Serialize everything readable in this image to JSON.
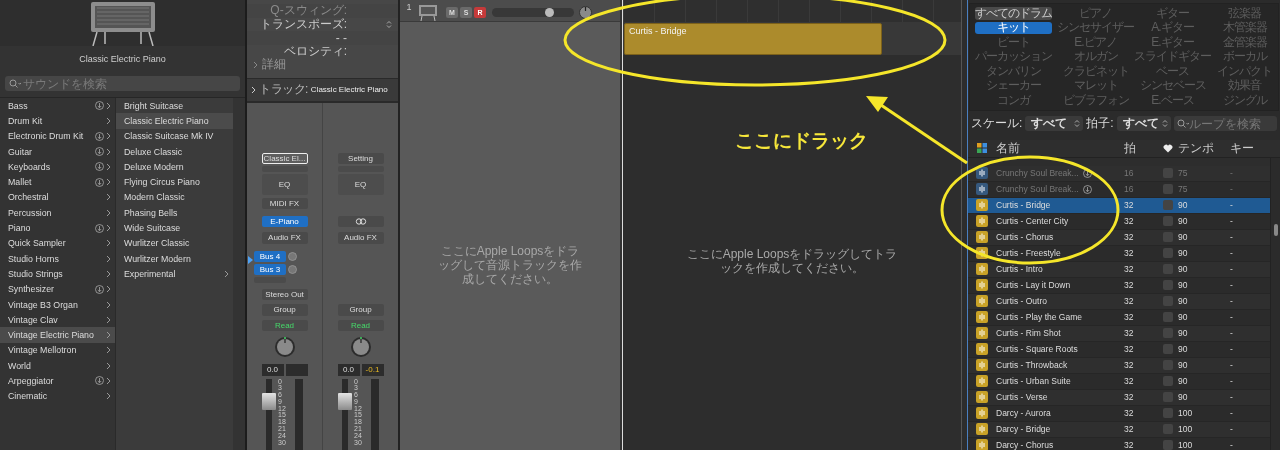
{
  "library": {
    "title": "Classic Electric Piano",
    "search": {
      "placeholder": "サウンドを検索"
    },
    "categories": [
      {
        "label": "Bass",
        "downloadable": true,
        "selected": false
      },
      {
        "label": "Drum Kit",
        "downloadable": false,
        "selected": false
      },
      {
        "label": "Electronic Drum Kit",
        "downloadable": true,
        "selected": false
      },
      {
        "label": "Guitar",
        "downloadable": true,
        "selected": false
      },
      {
        "label": "Keyboards",
        "downloadable": true,
        "selected": false
      },
      {
        "label": "Mallet",
        "downloadable": true,
        "selected": false
      },
      {
        "label": "Orchestral",
        "downloadable": false,
        "selected": false
      },
      {
        "label": "Percussion",
        "downloadable": false,
        "selected": false
      },
      {
        "label": "Piano",
        "downloadable": true,
        "selected": false
      },
      {
        "label": "Quick Sampler",
        "downloadable": false,
        "selected": false
      },
      {
        "label": "Studio Horns",
        "downloadable": false,
        "selected": false
      },
      {
        "label": "Studio Strings",
        "downloadable": false,
        "selected": false
      },
      {
        "label": "Synthesizer",
        "downloadable": true,
        "selected": false
      },
      {
        "label": "Vintage B3 Organ",
        "downloadable": false,
        "selected": false
      },
      {
        "label": "Vintage Clav",
        "downloadable": false,
        "selected": false
      },
      {
        "label": "Vintage Electric Piano",
        "downloadable": false,
        "selected": true
      },
      {
        "label": "Vintage Mellotron",
        "downloadable": false,
        "selected": false
      },
      {
        "label": "World",
        "downloadable": false,
        "selected": false
      },
      {
        "label": "Arpeggiator",
        "downloadable": true,
        "selected": false
      },
      {
        "label": "Cinematic",
        "downloadable": false,
        "selected": false
      }
    ],
    "presets": [
      {
        "label": "Bright Suitcase",
        "selected": false,
        "submenu": false
      },
      {
        "label": "Classic Electric Piano",
        "selected": true,
        "submenu": false
      },
      {
        "label": "Classic Suitcase Mk IV",
        "selected": false,
        "submenu": false
      },
      {
        "label": "Deluxe Classic",
        "selected": false,
        "submenu": false
      },
      {
        "label": "Deluxe Modern",
        "selected": false,
        "submenu": false
      },
      {
        "label": "Flying Circus Piano",
        "selected": false,
        "submenu": false
      },
      {
        "label": "Modern Classic",
        "selected": false,
        "submenu": false
      },
      {
        "label": "Phasing Bells",
        "selected": false,
        "submenu": false
      },
      {
        "label": "Wide Suitcase",
        "selected": false,
        "submenu": false
      },
      {
        "label": "Wurlitzer Classic",
        "selected": false,
        "submenu": false
      },
      {
        "label": "Wurlitzer Modern",
        "selected": false,
        "submenu": false
      },
      {
        "label": "Experimental",
        "selected": false,
        "submenu": true
      }
    ]
  },
  "inspector": {
    "rows": [
      {
        "label": "Q-スウィング:",
        "kind": "plain",
        "disabled": true
      },
      {
        "label": "トランスポーズ:",
        "kind": "stepper",
        "disabled": false
      },
      {
        "label": "- -",
        "kind": "value",
        "disabled": false
      },
      {
        "label": "ベロシティ:",
        "kind": "plain",
        "disabled": false
      }
    ],
    "details": "詳細",
    "track_header": {
      "label": "トラック:",
      "name": "Classic Electric Piano"
    },
    "strips": [
      {
        "selected": true,
        "setting": "Classic El...",
        "eq": "EQ",
        "midi_fx": "MIDI FX",
        "instrument": "E-Piano",
        "link": false,
        "audio_fx": "Audio FX",
        "sends": [
          {
            "label": "Bus 4"
          },
          {
            "label": "Bus 3"
          }
        ],
        "output": "Stereo Out",
        "group": "Group",
        "automation": "Read",
        "volume": "0.0",
        "level": 0.73,
        "scale": [
          "0",
          "3",
          "6",
          "9",
          "12",
          "15",
          "18",
          "21",
          "24",
          "30"
        ]
      },
      {
        "selected": false,
        "setting": "Setting",
        "eq": "EQ",
        "link": true,
        "audio_fx": "Audio FX",
        "group": "Group",
        "automation": "Read",
        "volume": "0.0",
        "peak": "-0.1",
        "level": 0.73,
        "scale": [
          "0",
          "3",
          "6",
          "9",
          "12",
          "15",
          "18",
          "21",
          "24",
          "30"
        ]
      }
    ]
  },
  "track": {
    "number": "1",
    "buttons": [
      {
        "label": "M",
        "kind": "mute",
        "on": false
      },
      {
        "label": "S",
        "kind": "solo",
        "on": false
      },
      {
        "label": "R",
        "kind": "record",
        "on": true
      }
    ],
    "volume": {
      "level": 0.72
    },
    "hint": "ここにApple Loopsをドラッグして音源トラックを作成してください。"
  },
  "workspace": {
    "region": {
      "name": "Curtis - Bridge"
    },
    "hint": "ここにApple Loopsをドラッグしてトラックを作成してください。"
  },
  "loop_browser": {
    "categories": [
      {
        "label": "すべてのドラム",
        "selected": false,
        "disabled": false
      },
      {
        "label": "ピアノ",
        "selected": false,
        "disabled": true
      },
      {
        "label": "ギター",
        "selected": false,
        "disabled": true
      },
      {
        "label": "弦楽器",
        "selected": false,
        "disabled": true
      },
      {
        "label": "キット",
        "selected": true,
        "disabled": false
      },
      {
        "label": "シンセサイザー",
        "selected": false,
        "disabled": true
      },
      {
        "label": "A.ギター",
        "selected": false,
        "disabled": true
      },
      {
        "label": "木管楽器",
        "selected": false,
        "disabled": true
      },
      {
        "label": "ビート",
        "selected": false,
        "disabled": true
      },
      {
        "label": "E.ピアノ",
        "selected": false,
        "disabled": true
      },
      {
        "label": "E.ギター",
        "selected": false,
        "disabled": true
      },
      {
        "label": "金管楽器",
        "selected": false,
        "disabled": true
      },
      {
        "label": "パーカッション",
        "selected": false,
        "disabled": true
      },
      {
        "label": "オルガン",
        "selected": false,
        "disabled": true
      },
      {
        "label": "スライドギター",
        "selected": false,
        "disabled": true
      },
      {
        "label": "ボーカル",
        "selected": false,
        "disabled": true
      },
      {
        "label": "タンバリン",
        "selected": false,
        "disabled": true
      },
      {
        "label": "クラビネット",
        "selected": false,
        "disabled": true
      },
      {
        "label": "ベース",
        "selected": false,
        "disabled": true
      },
      {
        "label": "インパクト",
        "selected": false,
        "disabled": true
      },
      {
        "label": "シェーカー",
        "selected": false,
        "disabled": true
      },
      {
        "label": "マレット",
        "selected": false,
        "disabled": true
      },
      {
        "label": "シンセベース",
        "selected": false,
        "disabled": true
      },
      {
        "label": "効果音",
        "selected": false,
        "disabled": true
      },
      {
        "label": "コンガ",
        "selected": false,
        "disabled": true
      },
      {
        "label": "ビブラフォン",
        "selected": false,
        "disabled": true
      },
      {
        "label": "E.ベース",
        "selected": false,
        "disabled": true
      },
      {
        "label": "ジングル",
        "selected": false,
        "disabled": true
      }
    ],
    "filters": [
      {
        "label": "スケール:",
        "value": "すべて"
      },
      {
        "label": "拍子:",
        "value": "すべて"
      }
    ],
    "search": {
      "placeholder": "ループを検索"
    },
    "columns": {
      "name": "名前",
      "beats": "拍",
      "tempo": "テンポ",
      "key": "キー"
    },
    "rows": [
      {
        "name": "Crunchy Soul Break...",
        "beats": "16",
        "tempo": "75",
        "key": "-",
        "color": "#36597e",
        "disabled": true,
        "downloadable": true,
        "favorite": false,
        "selected": false
      },
      {
        "name": "Crunchy Soul Break...",
        "beats": "16",
        "tempo": "75",
        "key": "-",
        "color": "#36597e",
        "disabled": true,
        "downloadable": true,
        "favorite": false,
        "selected": false
      },
      {
        "name": "Curtis - Bridge",
        "beats": "32",
        "tempo": "90",
        "key": "-",
        "color": "#c9a227",
        "disabled": false,
        "downloadable": false,
        "favorite": false,
        "selected": true
      },
      {
        "name": "Curtis - Center City",
        "beats": "32",
        "tempo": "90",
        "key": "-",
        "color": "#c9a227",
        "disabled": false,
        "downloadable": false,
        "favorite": false,
        "selected": false
      },
      {
        "name": "Curtis - Chorus",
        "beats": "32",
        "tempo": "90",
        "key": "-",
        "color": "#c9a227",
        "disabled": false,
        "downloadable": false,
        "favorite": false,
        "selected": false
      },
      {
        "name": "Curtis - Freestyle",
        "beats": "32",
        "tempo": "90",
        "key": "-",
        "color": "#c9a227",
        "disabled": false,
        "downloadable": false,
        "favorite": false,
        "selected": false
      },
      {
        "name": "Curtis - Intro",
        "beats": "32",
        "tempo": "90",
        "key": "-",
        "color": "#c9a227",
        "disabled": false,
        "downloadable": false,
        "favorite": false,
        "selected": false
      },
      {
        "name": "Curtis - Lay it Down",
        "beats": "32",
        "tempo": "90",
        "key": "-",
        "color": "#c9a227",
        "disabled": false,
        "downloadable": false,
        "favorite": false,
        "selected": false
      },
      {
        "name": "Curtis - Outro",
        "beats": "32",
        "tempo": "90",
        "key": "-",
        "color": "#c9a227",
        "disabled": false,
        "downloadable": false,
        "favorite": false,
        "selected": false
      },
      {
        "name": "Curtis - Play the Game",
        "beats": "32",
        "tempo": "90",
        "key": "-",
        "color": "#c9a227",
        "disabled": false,
        "downloadable": false,
        "favorite": false,
        "selected": false
      },
      {
        "name": "Curtis - Rim Shot",
        "beats": "32",
        "tempo": "90",
        "key": "-",
        "color": "#c9a227",
        "disabled": false,
        "downloadable": false,
        "favorite": false,
        "selected": false
      },
      {
        "name": "Curtis - Square Roots",
        "beats": "32",
        "tempo": "90",
        "key": "-",
        "color": "#c9a227",
        "disabled": false,
        "downloadable": false,
        "favorite": false,
        "selected": false
      },
      {
        "name": "Curtis - Throwback",
        "beats": "32",
        "tempo": "90",
        "key": "-",
        "color": "#c9a227",
        "disabled": false,
        "downloadable": false,
        "favorite": false,
        "selected": false
      },
      {
        "name": "Curtis - Urban Suite",
        "beats": "32",
        "tempo": "90",
        "key": "-",
        "color": "#c9a227",
        "disabled": false,
        "downloadable": false,
        "favorite": false,
        "selected": false
      },
      {
        "name": "Curtis - Verse",
        "beats": "32",
        "tempo": "90",
        "key": "-",
        "color": "#c9a227",
        "disabled": false,
        "downloadable": false,
        "favorite": false,
        "selected": false
      },
      {
        "name": "Darcy - Aurora",
        "beats": "32",
        "tempo": "100",
        "key": "-",
        "color": "#c9a227",
        "disabled": false,
        "downloadable": false,
        "favorite": false,
        "selected": false
      },
      {
        "name": "Darcy - Bridge",
        "beats": "32",
        "tempo": "100",
        "key": "-",
        "color": "#c9a227",
        "disabled": false,
        "downloadable": false,
        "favorite": false,
        "selected": false
      },
      {
        "name": "Darcy - Chorus",
        "beats": "32",
        "tempo": "100",
        "key": "-",
        "color": "#c9a227",
        "disabled": false,
        "downloadable": false,
        "favorite": false,
        "selected": false
      }
    ]
  },
  "annotation": {
    "label": "ここにドラック"
  }
}
